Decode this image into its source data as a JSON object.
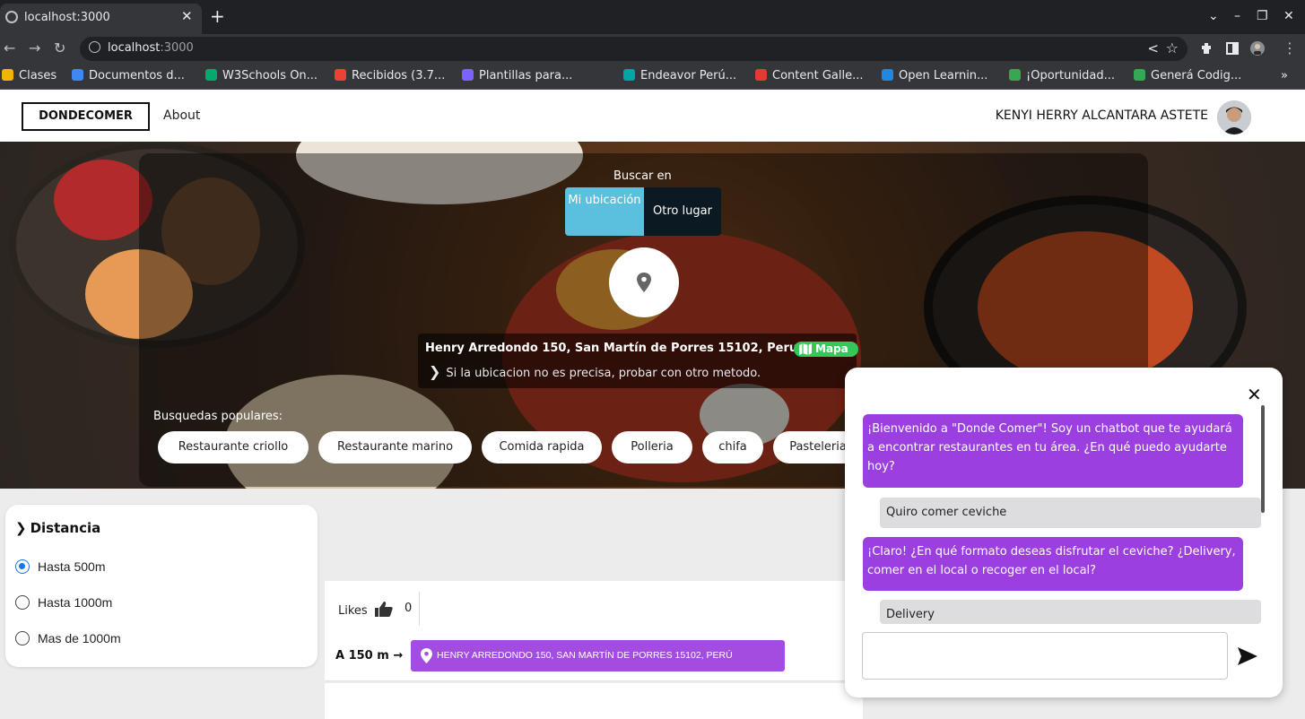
{
  "browser": {
    "tab_title": "localhost:3000",
    "url_host": "localhost",
    "url_port": ":3000",
    "bookmarks": [
      {
        "label": "Clases",
        "color": "#f4b400"
      },
      {
        "label": "Documentos d...",
        "color": "#4285f4"
      },
      {
        "label": "W3Schools On...",
        "color": "#04aa6d"
      },
      {
        "label": "Recibidos (3.7...",
        "color": "#ea4335"
      },
      {
        "label": "Plantillas para...",
        "color": "#7b61ff"
      },
      {
        "label": "Endeavor Perú...",
        "color": "#00a6a6"
      },
      {
        "label": "Content Galle...",
        "color": "#e53935"
      },
      {
        "label": "Open Learnin...",
        "color": "#1e88e5"
      },
      {
        "label": "¡Oportunidad...",
        "color": "#34a853"
      },
      {
        "label": "Generá Codig...",
        "color": "#34a853"
      }
    ]
  },
  "nav": {
    "brand": "DONDECOMER",
    "about": "About",
    "user_name": "KENYI HERRY ALCANTARA ASTETE"
  },
  "hero": {
    "search_in_label": "Buscar en",
    "option_my_location": "Mi ubicación",
    "option_other_place": "Otro lugar",
    "address": "Henry Arredondo 150, San Martín de Porres 15102, Peru",
    "map_label": "Mapa",
    "hint": "Si la ubicacion no es precisa, probar con otro metodo.",
    "popular_label": "Busquedas populares:",
    "popular": [
      "Restaurante criollo",
      "Restaurante marino",
      "Comida rapida",
      "Polleria",
      "chifa",
      "Pasteleria"
    ]
  },
  "filters": {
    "title": "Distancia",
    "options": [
      {
        "label": "Hasta 500m",
        "selected": true
      },
      {
        "label": "Hasta 1000m",
        "selected": false
      },
      {
        "label": "Mas de 1000m",
        "selected": false
      }
    ]
  },
  "result": {
    "likes_label": "Likes",
    "likes_count": "0",
    "distance": "A 150 m",
    "address_tag": "HENRY ARREDONDO 150, SAN MARTÍN DE PORRES 15102, PERÚ"
  },
  "chat": {
    "messages": [
      {
        "role": "bot",
        "text": "¡Bienvenido a \"Donde Comer\"! Soy un chatbot que te ayudará a encontrar restaurantes en tu área. ¿En qué puedo ayudarte hoy?"
      },
      {
        "role": "user",
        "text": "Quiro comer ceviche"
      },
      {
        "role": "bot",
        "text": "¡Claro! ¿En qué formato deseas disfrutar el ceviche? ¿Delivery, comer en el local o recoger en el local?"
      },
      {
        "role": "user",
        "text": "Delivery"
      }
    ],
    "input_value": ""
  },
  "colors": {
    "accent_blue": "#5bc0de",
    "chat_purple": "#9b3fe0",
    "tag_purple": "#a24ddf",
    "map_green": "#34c759"
  }
}
